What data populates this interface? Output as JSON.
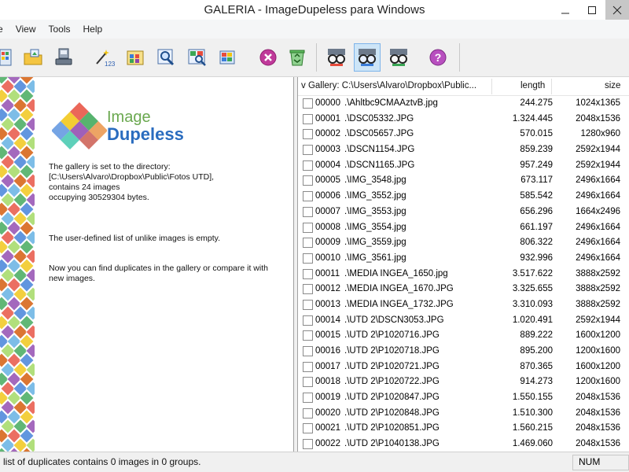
{
  "window": {
    "title": "GALERIA - ImageDupeless para Windows"
  },
  "menu": {
    "items": [
      "e",
      "View",
      "Tools",
      "Help"
    ]
  },
  "toolbar": {
    "icons": [
      "open-gallery-icon",
      "open-folder-icon",
      "scan-drive-icon",
      "magic-wand-123-icon",
      "thumbnails-grid-icon",
      "search-image-icon",
      "compare-image-icon",
      "refresh-image-icon",
      "stop-icon",
      "recycle-bin-icon",
      "glasses-mode-1-icon",
      "glasses-mode-2-icon",
      "glasses-mode-3-icon",
      "help-icon"
    ]
  },
  "info_panel": {
    "logo_line1": "Image",
    "logo_line2": "Dupeless",
    "para1_line1": "The gallery is set to the directory:",
    "para1_line2": "[C:\\Users\\Alvaro\\Dropbox\\Public\\Fotos UTD],",
    "para1_line3": "contains 24 images",
    "para1_line4": "occupying 30529304 bytes.",
    "para2": "The user-defined list of unlike images is empty.",
    "para3_line1": "Now you can find duplicates in the gallery or compare it with",
    "para3_line2": "new images."
  },
  "list": {
    "header": {
      "gallery": "v Gallery: C:\\Users\\Alvaro\\Dropbox\\Public...",
      "length": "length",
      "size": "size"
    },
    "rows": [
      {
        "idx": "00000",
        "name": ".\\Ahltbc9CMAAztvB.jpg",
        "length": "244.275",
        "size": "1024x1365"
      },
      {
        "idx": "00001",
        "name": ".\\DSC05332.JPG",
        "length": "1.324.445",
        "size": "2048x1536"
      },
      {
        "idx": "00002",
        "name": ".\\DSC05657.JPG",
        "length": "570.015",
        "size": "1280x960"
      },
      {
        "idx": "00003",
        "name": ".\\DSCN1154.JPG",
        "length": "859.239",
        "size": "2592x1944"
      },
      {
        "idx": "00004",
        "name": ".\\DSCN1165.JPG",
        "length": "957.249",
        "size": "2592x1944"
      },
      {
        "idx": "00005",
        "name": ".\\IMG_3548.jpg",
        "length": "673.117",
        "size": "2496x1664"
      },
      {
        "idx": "00006",
        "name": ".\\IMG_3552.jpg",
        "length": "585.542",
        "size": "2496x1664"
      },
      {
        "idx": "00007",
        "name": ".\\IMG_3553.jpg",
        "length": "656.296",
        "size": "1664x2496"
      },
      {
        "idx": "00008",
        "name": ".\\IMG_3554.jpg",
        "length": "661.197",
        "size": "2496x1664"
      },
      {
        "idx": "00009",
        "name": ".\\IMG_3559.jpg",
        "length": "806.322",
        "size": "2496x1664"
      },
      {
        "idx": "00010",
        "name": ".\\IMG_3561.jpg",
        "length": "932.996",
        "size": "2496x1664"
      },
      {
        "idx": "00011",
        "name": ".\\MEDIA INGEA_1650.jpg",
        "length": "3.517.622",
        "size": "3888x2592"
      },
      {
        "idx": "00012",
        "name": ".\\MEDIA INGEA_1670.JPG",
        "length": "3.325.655",
        "size": "3888x2592"
      },
      {
        "idx": "00013",
        "name": ".\\MEDIA INGEA_1732.JPG",
        "length": "3.310.093",
        "size": "3888x2592"
      },
      {
        "idx": "00014",
        "name": ".\\UTD 2\\DSCN3053.JPG",
        "length": "1.020.491",
        "size": "2592x1944"
      },
      {
        "idx": "00015",
        "name": ".\\UTD 2\\P1020716.JPG",
        "length": "889.222",
        "size": "1600x1200"
      },
      {
        "idx": "00016",
        "name": ".\\UTD 2\\P1020718.JPG",
        "length": "895.200",
        "size": "1200x1600"
      },
      {
        "idx": "00017",
        "name": ".\\UTD 2\\P1020721.JPG",
        "length": "870.365",
        "size": "1600x1200"
      },
      {
        "idx": "00018",
        "name": ".\\UTD 2\\P1020722.JPG",
        "length": "914.273",
        "size": "1200x1600"
      },
      {
        "idx": "00019",
        "name": ".\\UTD 2\\P1020847.JPG",
        "length": "1.550.155",
        "size": "2048x1536"
      },
      {
        "idx": "00020",
        "name": ".\\UTD 2\\P1020848.JPG",
        "length": "1.510.300",
        "size": "2048x1536"
      },
      {
        "idx": "00021",
        "name": ".\\UTD 2\\P1020851.JPG",
        "length": "1.560.215",
        "size": "2048x1536"
      },
      {
        "idx": "00022",
        "name": ".\\UTD 2\\P1040138.JPG",
        "length": "1.469.060",
        "size": "2048x1536"
      }
    ]
  },
  "status": {
    "text": "list of duplicates contains 0 images in 0 groups.",
    "num": "NUM"
  }
}
